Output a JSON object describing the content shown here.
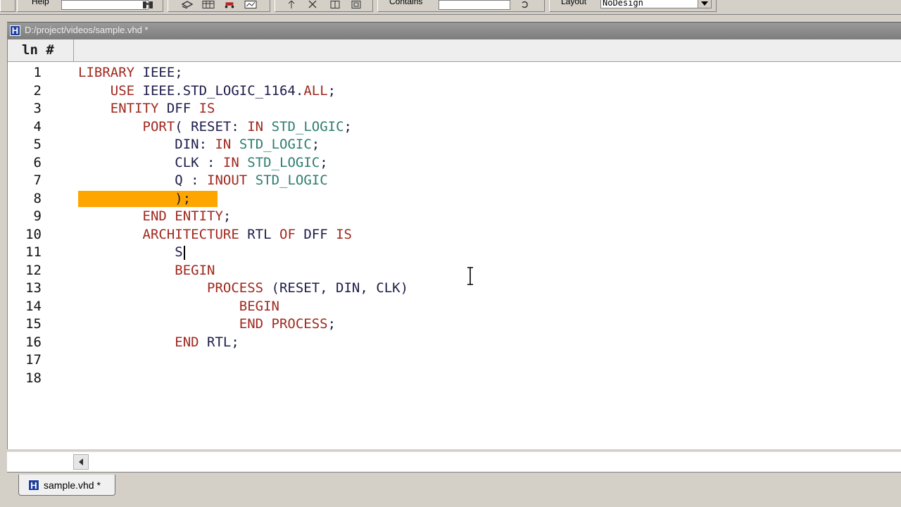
{
  "toolbar": {
    "help_label": "Help",
    "contains_label": "Contains",
    "layout_label": "Layout",
    "layout_value": "NoDesign"
  },
  "window": {
    "title": "D:/project/videos/sample.vhd *"
  },
  "editor": {
    "ln_header": "ln #",
    "lines": [
      {
        "n": "1",
        "tokens": [
          {
            "t": "LIBRARY ",
            "c": "kw"
          },
          {
            "t": "IEEE;",
            "c": "id"
          }
        ]
      },
      {
        "n": "2",
        "tokens": [
          {
            "t": "    "
          },
          {
            "t": "USE ",
            "c": "kw"
          },
          {
            "t": "IEEE.STD_LOGIC_1164.",
            "c": "id"
          },
          {
            "t": "ALL",
            "c": "kw"
          },
          {
            "t": ";",
            "c": "id"
          }
        ]
      },
      {
        "n": "3",
        "tokens": [
          {
            "t": "    "
          },
          {
            "t": "ENTITY ",
            "c": "kw"
          },
          {
            "t": "DFF ",
            "c": "id"
          },
          {
            "t": "IS",
            "c": "kw"
          }
        ]
      },
      {
        "n": "4",
        "tokens": [
          {
            "t": "        "
          },
          {
            "t": "PORT",
            "c": "kw"
          },
          {
            "t": "( RESET: ",
            "c": "id"
          },
          {
            "t": "IN ",
            "c": "kw"
          },
          {
            "t": "STD_LOGIC",
            "c": "tp"
          },
          {
            "t": ";",
            "c": "id"
          }
        ]
      },
      {
        "n": "5",
        "tokens": [
          {
            "t": "            "
          },
          {
            "t": "DIN: ",
            "c": "id"
          },
          {
            "t": "IN ",
            "c": "kw"
          },
          {
            "t": "STD_LOGIC",
            "c": "tp"
          },
          {
            "t": ";",
            "c": "id"
          }
        ]
      },
      {
        "n": "6",
        "tokens": [
          {
            "t": "            "
          },
          {
            "t": "CLK : ",
            "c": "id"
          },
          {
            "t": "IN ",
            "c": "kw"
          },
          {
            "t": "STD_LOGIC",
            "c": "tp"
          },
          {
            "t": ";",
            "c": "id"
          }
        ]
      },
      {
        "n": "7",
        "tokens": [
          {
            "t": "            "
          },
          {
            "t": "Q : ",
            "c": "id"
          },
          {
            "t": "INOUT ",
            "c": "kw"
          },
          {
            "t": "STD_LOGIC",
            "c": "tp"
          }
        ]
      },
      {
        "n": "8",
        "highlight": true,
        "tokens": [
          {
            "t": "            "
          },
          {
            "t": ");",
            "c": "id"
          }
        ]
      },
      {
        "n": "9",
        "tokens": [
          {
            "t": "        "
          },
          {
            "t": "END ",
            "c": "kw"
          },
          {
            "t": "ENTITY",
            "c": "kw"
          },
          {
            "t": ";",
            "c": "id"
          }
        ]
      },
      {
        "n": "10",
        "tokens": [
          {
            "t": "        "
          },
          {
            "t": "ARCHITECTURE ",
            "c": "kw"
          },
          {
            "t": "RTL ",
            "c": "id"
          },
          {
            "t": "OF ",
            "c": "kw"
          },
          {
            "t": "DFF ",
            "c": "id"
          },
          {
            "t": "IS",
            "c": "kw"
          }
        ]
      },
      {
        "n": "11",
        "caret": true,
        "tokens": [
          {
            "t": "            "
          },
          {
            "t": "S",
            "c": "id"
          }
        ]
      },
      {
        "n": "12",
        "tokens": [
          {
            "t": "            "
          },
          {
            "t": "BEGIN",
            "c": "kw"
          }
        ]
      },
      {
        "n": "13",
        "tokens": [
          {
            "t": "                "
          },
          {
            "t": "PROCESS ",
            "c": "kw"
          },
          {
            "t": "(RESET, DIN, CLK)",
            "c": "id"
          }
        ]
      },
      {
        "n": "14",
        "tokens": [
          {
            "t": "                    "
          },
          {
            "t": "BEGIN",
            "c": "kw"
          }
        ]
      },
      {
        "n": "15",
        "tokens": [
          {
            "t": "                    "
          },
          {
            "t": "END ",
            "c": "kw"
          },
          {
            "t": "PROCESS",
            "c": "kw"
          },
          {
            "t": ";",
            "c": "id"
          }
        ]
      },
      {
        "n": "16",
        "tokens": [
          {
            "t": "            "
          },
          {
            "t": "END ",
            "c": "kw"
          },
          {
            "t": "RTL;",
            "c": "id"
          }
        ]
      },
      {
        "n": "17",
        "tokens": []
      },
      {
        "n": "18",
        "tokens": []
      }
    ]
  },
  "tabs": {
    "file_tab": "sample.vhd *"
  },
  "colors": {
    "keyword": "#a0281e",
    "type": "#2e7d6e",
    "identifier": "#1c1c4a",
    "highlight": "#ffa500"
  }
}
